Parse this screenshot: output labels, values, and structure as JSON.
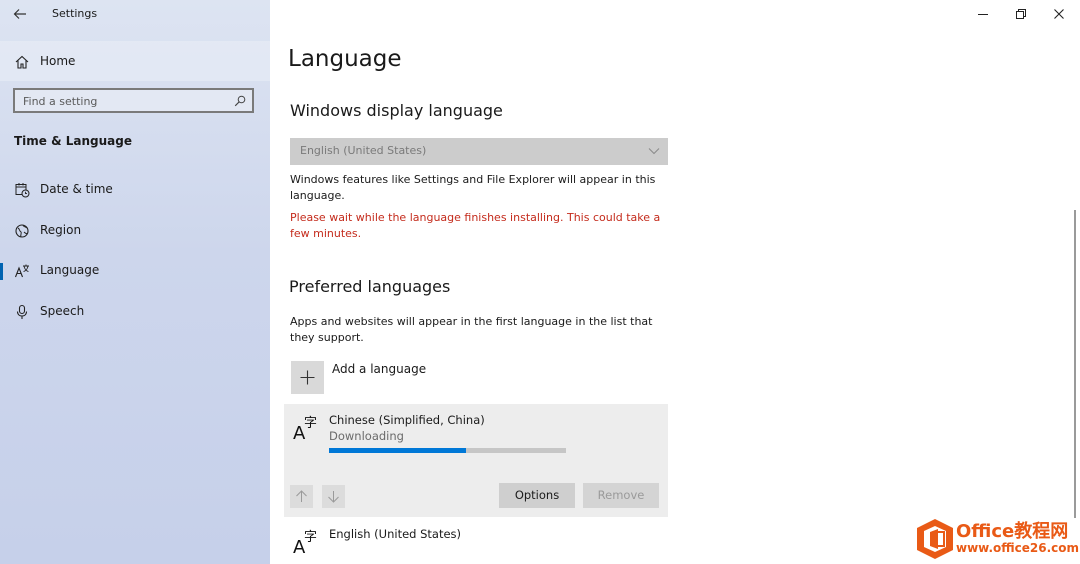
{
  "window": {
    "app_title": "Settings",
    "minimize_icon": "minimize-icon",
    "maximize_icon": "restore-icon",
    "close_icon": "close-icon"
  },
  "sidebar": {
    "home_label": "Home",
    "search_placeholder": "Find a setting",
    "section_title": "Time & Language",
    "items": [
      {
        "label": "Date & time",
        "icon": "calendar-clock-icon"
      },
      {
        "label": "Region",
        "icon": "globe-icon"
      },
      {
        "label": "Language",
        "icon": "language-icon",
        "active": true
      },
      {
        "label": "Speech",
        "icon": "microphone-icon"
      }
    ]
  },
  "main": {
    "page_title": "Language",
    "display_section": {
      "heading": "Windows display language",
      "selected_value": "English (United States)",
      "description": "Windows features like Settings and File Explorer will appear in this language.",
      "warning": "Please wait while the language finishes installing. This could take a few minutes."
    },
    "preferred_section": {
      "heading": "Preferred languages",
      "description": "Apps and websites will appear in the first language in the list that they support.",
      "add_label": "Add a language",
      "languages": [
        {
          "name": "Chinese (Simplified, China)",
          "status": "Downloading",
          "progress": 0.58,
          "options_label": "Options",
          "remove_label": "Remove"
        },
        {
          "name": "English (United States)"
        }
      ]
    }
  },
  "watermark": {
    "brand": "Office教程网",
    "url": "www.office26.com"
  },
  "colors": {
    "accent": "#0078d7",
    "warning": "#c42b1c",
    "brand": "#e95a16"
  }
}
